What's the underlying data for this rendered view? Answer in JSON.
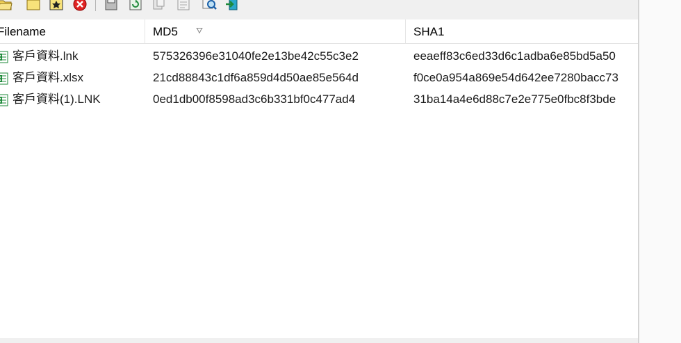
{
  "toolbar": {
    "buttons": [
      {
        "icon": "open-folder-icon"
      },
      {
        "icon": "new-folder-icon"
      },
      {
        "icon": "star-icon"
      },
      {
        "icon": "stop-icon"
      },
      {
        "icon": "save-icon"
      },
      {
        "icon": "refresh-icon"
      },
      {
        "icon": "copy-icon"
      },
      {
        "icon": "properties-icon"
      },
      {
        "icon": "find-icon"
      },
      {
        "icon": "exit-icon"
      }
    ]
  },
  "columns": [
    {
      "label": "Filename"
    },
    {
      "label": "MD5",
      "sorted": "descending"
    },
    {
      "label": "SHA1"
    }
  ],
  "rows": [
    {
      "filename": "客戶資料.lnk",
      "md5": "575326396e31040fe2e13be42c55c3e2",
      "sha1": "eeaeff83c6ed33d6c1adba6e85bd5a50"
    },
    {
      "filename": "客戶資料.xlsx",
      "md5": "21cd88843c1df6a859d4d50ae85e564d",
      "sha1": "f0ce0a954a869e54d642ee7280bacc73"
    },
    {
      "filename": "客戶資料(1).LNK",
      "md5": "0ed1db00f8598ad3c6b331bf0c477ad4",
      "sha1": "31ba14a4e6d88c7e2e775e0fbc8f3bde"
    }
  ],
  "colors": {
    "list_background": "#ffffff",
    "window_background": "#f0f0f0",
    "icon_green": "#1e8a3a"
  }
}
